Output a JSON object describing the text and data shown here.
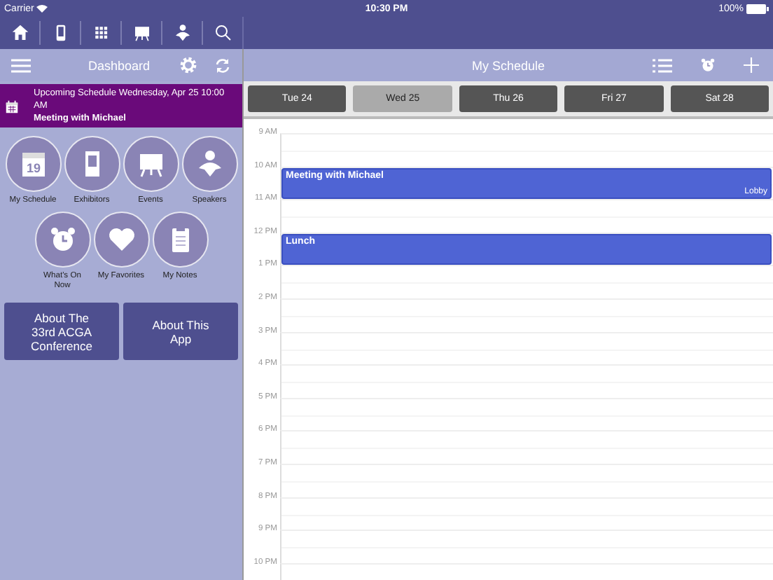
{
  "status_bar": {
    "carrier": "Carrier",
    "time": "10:30 PM",
    "battery": "100%"
  },
  "toolbar": [
    {
      "kind": "home"
    },
    {
      "kind": "phone"
    },
    {
      "kind": "grid"
    },
    {
      "kind": "easel"
    },
    {
      "kind": "person"
    },
    {
      "kind": "search"
    }
  ],
  "dashboard": {
    "title": "Dashboard",
    "upcoming": {
      "text": "Upcoming Schedule Wednesday, Apr 25 10:00 AM",
      "event": "Meeting with Michael"
    },
    "tiles": [
      {
        "kind": "calendar",
        "label": "My Schedule",
        "badge": "19"
      },
      {
        "kind": "booth",
        "label": "Exhibitors"
      },
      {
        "kind": "easel",
        "label": "Events"
      },
      {
        "kind": "person",
        "label": "Speakers"
      },
      {
        "kind": "clock",
        "label": "What's On Now"
      },
      {
        "kind": "heart",
        "label": "My Favorites"
      },
      {
        "kind": "clipboard",
        "label": "My Notes"
      }
    ],
    "buttons": [
      "About The 33rd ACGA Conference",
      "About This App"
    ]
  },
  "schedule": {
    "title": "My Schedule",
    "days": [
      {
        "label": "Tue 24",
        "selected": false
      },
      {
        "label": "Wed 25",
        "selected": true
      },
      {
        "label": "Thu 26",
        "selected": false
      },
      {
        "label": "Fri 27",
        "selected": false
      },
      {
        "label": "Sat 28",
        "selected": false
      }
    ],
    "hours": [
      {
        "label": "9 AM"
      },
      {
        "label": "10 AM",
        "events": [
          {
            "title": "Meeting with Michael",
            "location": "Lobby"
          }
        ]
      },
      {
        "label": "11 AM"
      },
      {
        "label": "12 PM",
        "events": [
          {
            "title": "Lunch"
          }
        ]
      },
      {
        "label": "1 PM"
      },
      {
        "label": "2 PM"
      },
      {
        "label": "3 PM"
      },
      {
        "label": "4 PM"
      },
      {
        "label": "5 PM"
      },
      {
        "label": "6 PM"
      },
      {
        "label": "7 PM"
      },
      {
        "label": "8 PM"
      },
      {
        "label": "9 PM"
      },
      {
        "label": "10 PM"
      }
    ]
  }
}
